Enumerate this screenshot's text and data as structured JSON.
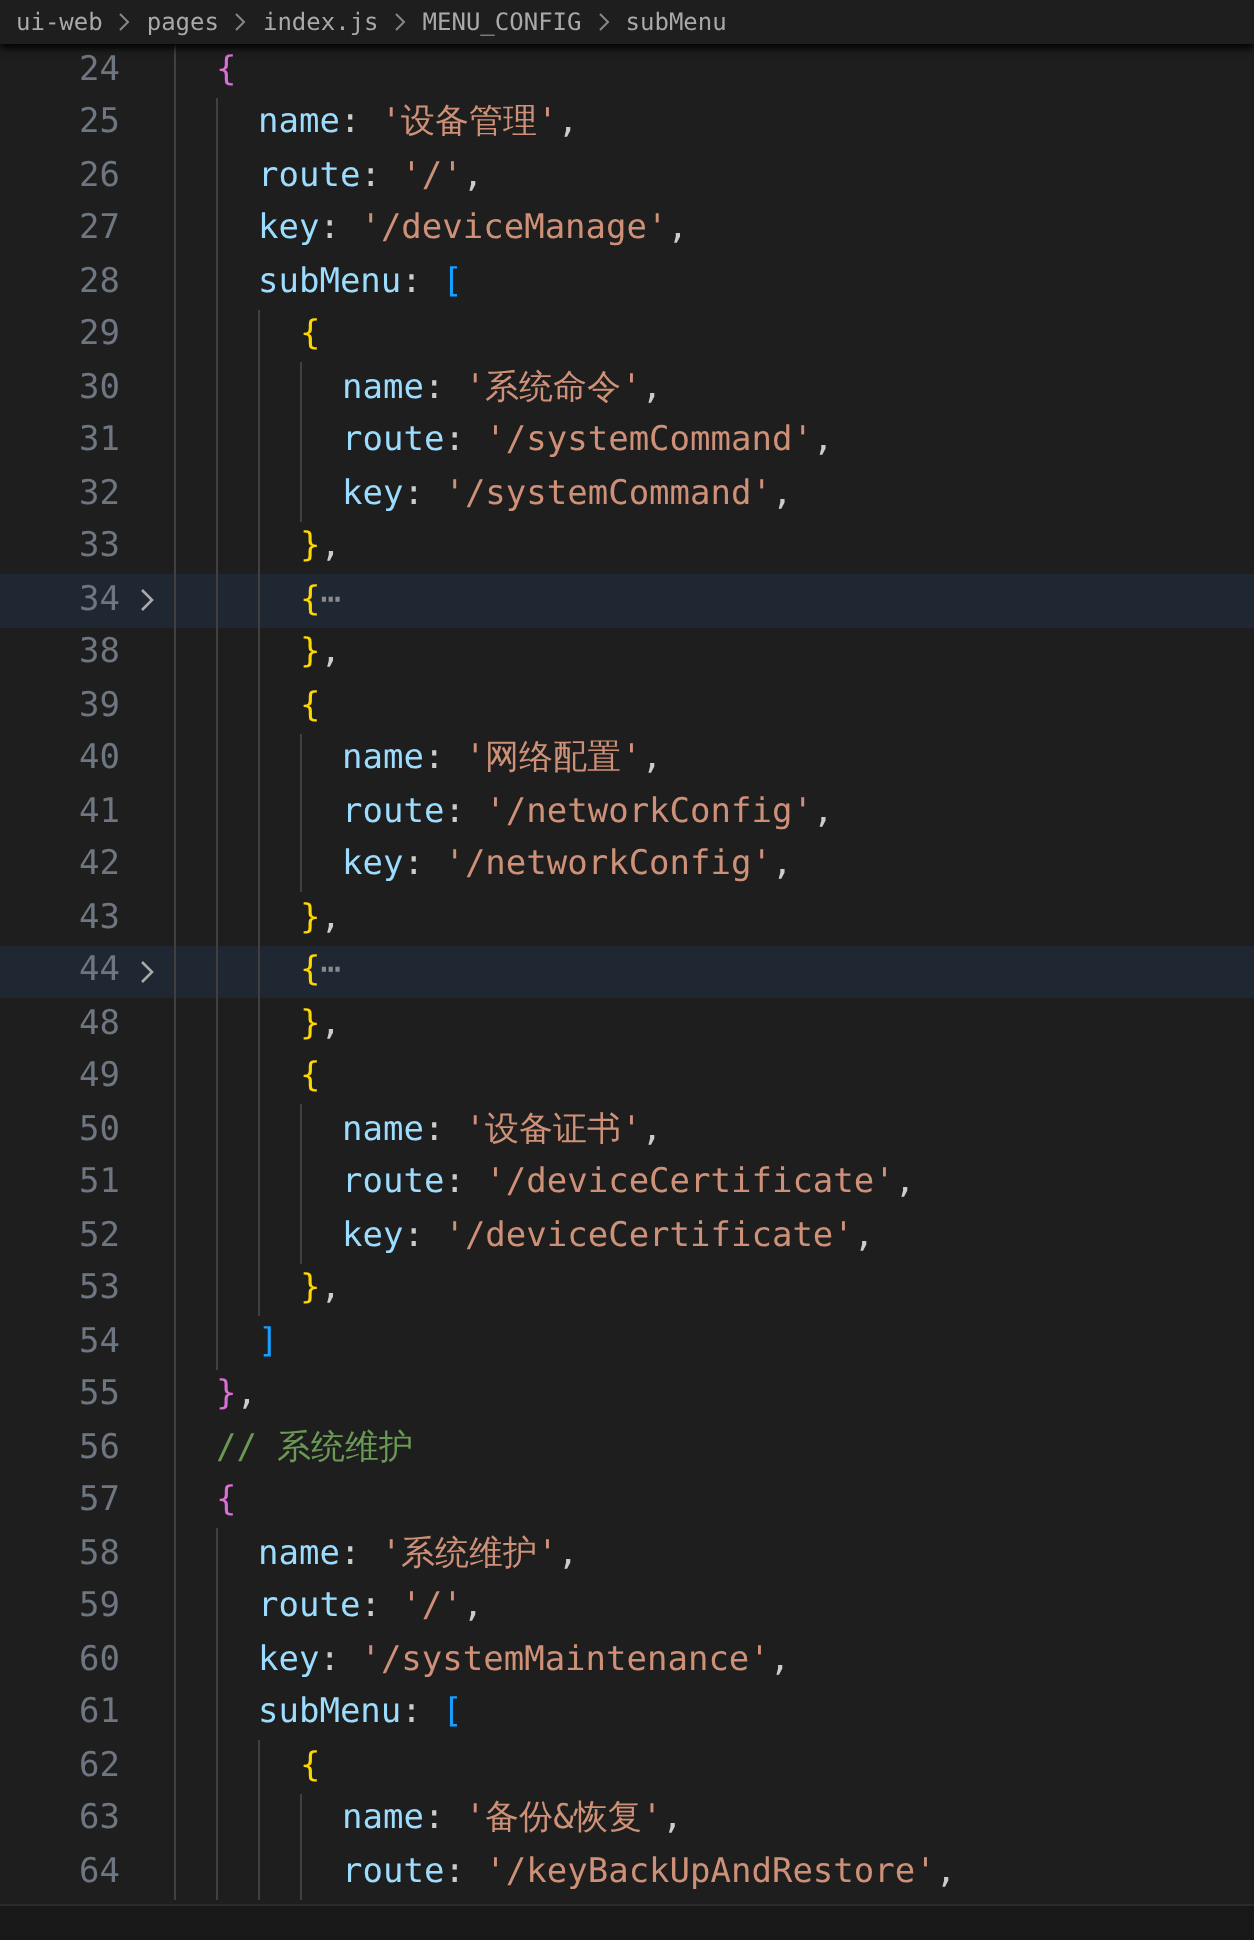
{
  "breadcrumb": [
    "ui-web",
    "pages",
    "index.js",
    "MENU_CONFIG",
    "subMenu"
  ],
  "lines": [
    {
      "number": "24",
      "folded": false,
      "tokens": [
        {
          "kind": "brace2",
          "text": "{"
        }
      ],
      "children": [
        {
          "number": "25",
          "folded": false,
          "tokens": [
            {
              "kind": "key",
              "text": "name"
            },
            {
              "kind": "punct",
              "text": ": "
            },
            {
              "kind": "string",
              "text": "'设备管理'"
            },
            {
              "kind": "punct",
              "text": ","
            }
          ]
        },
        {
          "number": "26",
          "folded": false,
          "tokens": [
            {
              "kind": "key",
              "text": "route"
            },
            {
              "kind": "punct",
              "text": ": "
            },
            {
              "kind": "string",
              "text": "'/'"
            },
            {
              "kind": "punct",
              "text": ","
            }
          ]
        },
        {
          "number": "27",
          "folded": false,
          "tokens": [
            {
              "kind": "key",
              "text": "key"
            },
            {
              "kind": "punct",
              "text": ": "
            },
            {
              "kind": "string",
              "text": "'/deviceManage'"
            },
            {
              "kind": "punct",
              "text": ","
            }
          ]
        },
        {
          "number": "28",
          "folded": false,
          "tokens": [
            {
              "kind": "key",
              "text": "subMenu"
            },
            {
              "kind": "punct",
              "text": ": "
            },
            {
              "kind": "brace3",
              "text": "["
            }
          ],
          "children": [
            {
              "number": "29",
              "folded": false,
              "tokens": [
                {
                  "kind": "brace1",
                  "text": "{"
                }
              ],
              "children": [
                {
                  "number": "30",
                  "folded": false,
                  "tokens": [
                    {
                      "kind": "key",
                      "text": "name"
                    },
                    {
                      "kind": "punct",
                      "text": ": "
                    },
                    {
                      "kind": "string",
                      "text": "'系统命令'"
                    },
                    {
                      "kind": "punct",
                      "text": ","
                    }
                  ]
                },
                {
                  "number": "31",
                  "folded": false,
                  "tokens": [
                    {
                      "kind": "key",
                      "text": "route"
                    },
                    {
                      "kind": "punct",
                      "text": ": "
                    },
                    {
                      "kind": "string",
                      "text": "'/systemCommand'"
                    },
                    {
                      "kind": "punct",
                      "text": ","
                    }
                  ]
                },
                {
                  "number": "32",
                  "folded": false,
                  "tokens": [
                    {
                      "kind": "key",
                      "text": "key"
                    },
                    {
                      "kind": "punct",
                      "text": ": "
                    },
                    {
                      "kind": "string",
                      "text": "'/systemCommand'"
                    },
                    {
                      "kind": "punct",
                      "text": ","
                    }
                  ]
                }
              ]
            },
            {
              "number": "33",
              "folded": false,
              "tokens": [
                {
                  "kind": "brace1",
                  "text": "}"
                },
                {
                  "kind": "punct",
                  "text": ","
                }
              ]
            },
            {
              "number": "34",
              "folded": true,
              "tokens": [
                {
                  "kind": "brace1",
                  "text": "{"
                },
                {
                  "kind": "ellipsis",
                  "text": "⋯"
                }
              ]
            },
            {
              "number": "38",
              "folded": false,
              "tokens": [
                {
                  "kind": "brace1",
                  "text": "}"
                },
                {
                  "kind": "punct",
                  "text": ","
                }
              ]
            },
            {
              "number": "39",
              "folded": false,
              "tokens": [
                {
                  "kind": "brace1",
                  "text": "{"
                }
              ],
              "children": [
                {
                  "number": "40",
                  "folded": false,
                  "tokens": [
                    {
                      "kind": "key",
                      "text": "name"
                    },
                    {
                      "kind": "punct",
                      "text": ": "
                    },
                    {
                      "kind": "string",
                      "text": "'网络配置'"
                    },
                    {
                      "kind": "punct",
                      "text": ","
                    }
                  ]
                },
                {
                  "number": "41",
                  "folded": false,
                  "tokens": [
                    {
                      "kind": "key",
                      "text": "route"
                    },
                    {
                      "kind": "punct",
                      "text": ": "
                    },
                    {
                      "kind": "string",
                      "text": "'/networkConfig'"
                    },
                    {
                      "kind": "punct",
                      "text": ","
                    }
                  ]
                },
                {
                  "number": "42",
                  "folded": false,
                  "tokens": [
                    {
                      "kind": "key",
                      "text": "key"
                    },
                    {
                      "kind": "punct",
                      "text": ": "
                    },
                    {
                      "kind": "string",
                      "text": "'/networkConfig'"
                    },
                    {
                      "kind": "punct",
                      "text": ","
                    }
                  ]
                }
              ]
            },
            {
              "number": "43",
              "folded": false,
              "tokens": [
                {
                  "kind": "brace1",
                  "text": "}"
                },
                {
                  "kind": "punct",
                  "text": ","
                }
              ]
            },
            {
              "number": "44",
              "folded": true,
              "tokens": [
                {
                  "kind": "brace1",
                  "text": "{"
                },
                {
                  "kind": "ellipsis",
                  "text": "⋯"
                }
              ]
            },
            {
              "number": "48",
              "folded": false,
              "tokens": [
                {
                  "kind": "brace1",
                  "text": "}"
                },
                {
                  "kind": "punct",
                  "text": ","
                }
              ]
            },
            {
              "number": "49",
              "folded": false,
              "tokens": [
                {
                  "kind": "brace1",
                  "text": "{"
                }
              ],
              "children": [
                {
                  "number": "50",
                  "folded": false,
                  "tokens": [
                    {
                      "kind": "key",
                      "text": "name"
                    },
                    {
                      "kind": "punct",
                      "text": ": "
                    },
                    {
                      "kind": "string",
                      "text": "'设备证书'"
                    },
                    {
                      "kind": "punct",
                      "text": ","
                    }
                  ]
                },
                {
                  "number": "51",
                  "folded": false,
                  "tokens": [
                    {
                      "kind": "key",
                      "text": "route"
                    },
                    {
                      "kind": "punct",
                      "text": ": "
                    },
                    {
                      "kind": "string",
                      "text": "'/deviceCertificate'"
                    },
                    {
                      "kind": "punct",
                      "text": ","
                    }
                  ]
                },
                {
                  "number": "52",
                  "folded": false,
                  "tokens": [
                    {
                      "kind": "key",
                      "text": "key"
                    },
                    {
                      "kind": "punct",
                      "text": ": "
                    },
                    {
                      "kind": "string",
                      "text": "'/deviceCertificate'"
                    },
                    {
                      "kind": "punct",
                      "text": ","
                    }
                  ]
                }
              ]
            },
            {
              "number": "53",
              "folded": false,
              "tokens": [
                {
                  "kind": "brace1",
                  "text": "}"
                },
                {
                  "kind": "punct",
                  "text": ","
                }
              ]
            }
          ]
        },
        {
          "number": "54",
          "folded": false,
          "tokens": [
            {
              "kind": "brace3",
              "text": "]"
            }
          ]
        }
      ]
    },
    {
      "number": "55",
      "folded": false,
      "tokens": [
        {
          "kind": "brace2",
          "text": "}"
        },
        {
          "kind": "punct",
          "text": ","
        }
      ]
    },
    {
      "number": "56",
      "folded": false,
      "tokens": [
        {
          "kind": "comment",
          "text": "// 系统维护"
        }
      ]
    },
    {
      "number": "57",
      "folded": false,
      "tokens": [
        {
          "kind": "brace2",
          "text": "{"
        }
      ],
      "children": [
        {
          "number": "58",
          "folded": false,
          "tokens": [
            {
              "kind": "key",
              "text": "name"
            },
            {
              "kind": "punct",
              "text": ": "
            },
            {
              "kind": "string",
              "text": "'系统维护'"
            },
            {
              "kind": "punct",
              "text": ","
            }
          ]
        },
        {
          "number": "59",
          "folded": false,
          "tokens": [
            {
              "kind": "key",
              "text": "route"
            },
            {
              "kind": "punct",
              "text": ": "
            },
            {
              "kind": "string",
              "text": "'/'"
            },
            {
              "kind": "punct",
              "text": ","
            }
          ]
        },
        {
          "number": "60",
          "folded": false,
          "tokens": [
            {
              "kind": "key",
              "text": "key"
            },
            {
              "kind": "punct",
              "text": ": "
            },
            {
              "kind": "string",
              "text": "'/systemMaintenance'"
            },
            {
              "kind": "punct",
              "text": ","
            }
          ]
        },
        {
          "number": "61",
          "folded": false,
          "tokens": [
            {
              "kind": "key",
              "text": "subMenu"
            },
            {
              "kind": "punct",
              "text": ": "
            },
            {
              "kind": "brace3",
              "text": "["
            }
          ],
          "children": [
            {
              "number": "62",
              "folded": false,
              "tokens": [
                {
                  "kind": "brace1",
                  "text": "{"
                }
              ],
              "children": [
                {
                  "number": "63",
                  "folded": false,
                  "tokens": [
                    {
                      "kind": "key",
                      "text": "name"
                    },
                    {
                      "kind": "punct",
                      "text": ": "
                    },
                    {
                      "kind": "string",
                      "text": "'备份&恢复'"
                    },
                    {
                      "kind": "punct",
                      "text": ","
                    }
                  ]
                },
                {
                  "number": "64",
                  "folded": false,
                  "tokens": [
                    {
                      "kind": "key",
                      "text": "route"
                    },
                    {
                      "kind": "punct",
                      "text": ": "
                    },
                    {
                      "kind": "string",
                      "text": "'/keyBackUpAndRestore'"
                    },
                    {
                      "kind": "punct",
                      "text": ","
                    }
                  ]
                }
              ]
            }
          ]
        }
      ]
    }
  ]
}
